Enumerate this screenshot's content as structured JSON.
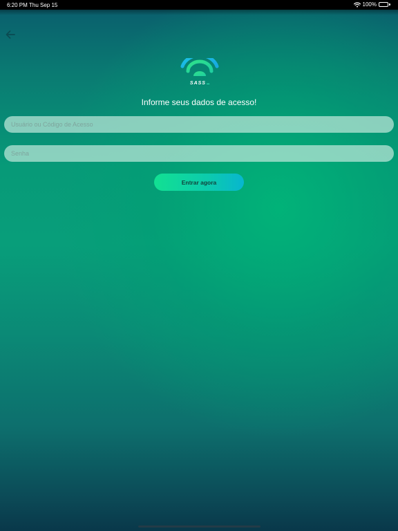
{
  "status_bar": {
    "time": "6:20 PM",
    "date": "Thu Sep 15",
    "battery": "100%",
    "battery_level": 1.0,
    "icons": [
      "wifi-icon",
      "battery-icon"
    ]
  },
  "navigation": {
    "back_icon": "arrow-left-icon"
  },
  "logo": {
    "icon": "wifi-logo-icon",
    "brand": "SASS"
  },
  "login": {
    "heading": "Informe seus dados de acesso!",
    "user_placeholder": "Usuário ou Código de Acesso",
    "user_value": "",
    "password_placeholder": "Senha",
    "password_value": "",
    "submit_label": "Entrar agora"
  },
  "colors": {
    "background_top": "#0a5f6d",
    "background_mid": "#089e7a",
    "background_bottom": "#09384a",
    "button_gradient_start": "#12e092",
    "button_gradient_end": "#08b6cf",
    "logo_blue": "#1cc4e6",
    "logo_green": "#2fe08a"
  }
}
